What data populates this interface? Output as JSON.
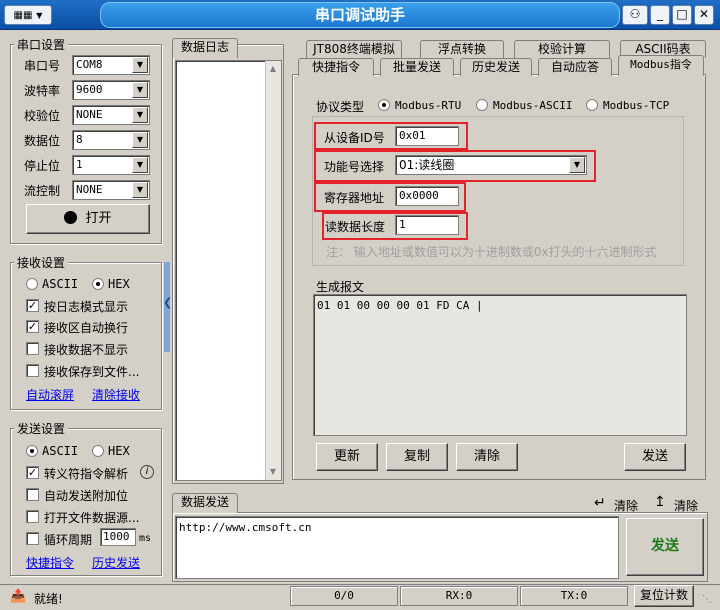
{
  "window": {
    "title": "串口调试助手",
    "menu_glyph": "▼",
    "min_label": "_",
    "max_label": "□",
    "close_label": "✕"
  },
  "serial_settings": {
    "title": "串口设置",
    "port": {
      "label": "串口号",
      "value": "COM8"
    },
    "baud": {
      "label": "波特率",
      "value": "9600"
    },
    "parity": {
      "label": "校验位",
      "value": "NONE"
    },
    "databits": {
      "label": "数据位",
      "value": "8"
    },
    "stopbits": {
      "label": "停止位",
      "value": "1"
    },
    "flow": {
      "label": "流控制",
      "value": "NONE"
    },
    "open_label": "打开"
  },
  "receive_settings": {
    "title": "接收设置",
    "ascii_label": "ASCII",
    "hex_label": "HEX",
    "log_mode": "按日志模式显示",
    "auto_wrap": "接收区自动换行",
    "hide_data": "接收数据不显示",
    "save_file": "接收保存到文件...",
    "auto_scroll": "自动滚屏",
    "clear_recv": "清除接收"
  },
  "send_settings": {
    "title": "发送设置",
    "ascii_label": "ASCII",
    "hex_label": "HEX",
    "escape": "转义符指令解析",
    "info": "i",
    "append_check": "自动发送附加位",
    "open_file": "打开文件数据源...",
    "cycle": "循环周期",
    "cycle_value": "1000",
    "cycle_unit": "ms",
    "quick_cmd": "快捷指令",
    "history": "历史发送"
  },
  "log": {
    "title": "数据日志"
  },
  "tabs_row1": [
    "JT808终端模拟",
    "浮点转换",
    "校验计算",
    "ASCII码表"
  ],
  "tabs_row2": [
    "快捷指令",
    "批量发送",
    "历史发送",
    "自动应答",
    "Modbus指令"
  ],
  "modbus": {
    "protocol_label": "协议类型",
    "rtu": "Modbus-RTU",
    "ascii": "Modbus-ASCII",
    "tcp": "Modbus-TCP",
    "slave_label": "从设备ID号",
    "slave_value": "0x01",
    "func_label": "功能号选择",
    "func_value": "01:读线圈",
    "reg_label": "寄存器地址",
    "reg_value": "0x0000",
    "len_label": "读数据长度",
    "len_value": "1",
    "note": "注： 输入地址或数值可以为十进制数或0x打头的十六进制形式",
    "gen_label": "生成报文",
    "gen_value": "01 01 00 00 00 01 FD CA |",
    "refresh": "更新",
    "copy": "复制",
    "clear": "清除",
    "send": "发送"
  },
  "data_send": {
    "title": "数据发送",
    "clear1": "清除",
    "clear2": "清除",
    "content": "http://www.cmsoft.cn",
    "send": "发送"
  },
  "status": {
    "ready": "就绪!",
    "count": "0/0",
    "rx": "RX:0",
    "tx": "TX:0",
    "reset": "复位计数"
  },
  "colors": {
    "title_bar": "#1c78d0",
    "highlight_red": "#e2232a",
    "send_green": "#1a7a1a",
    "link_blue": "#0000ee"
  }
}
